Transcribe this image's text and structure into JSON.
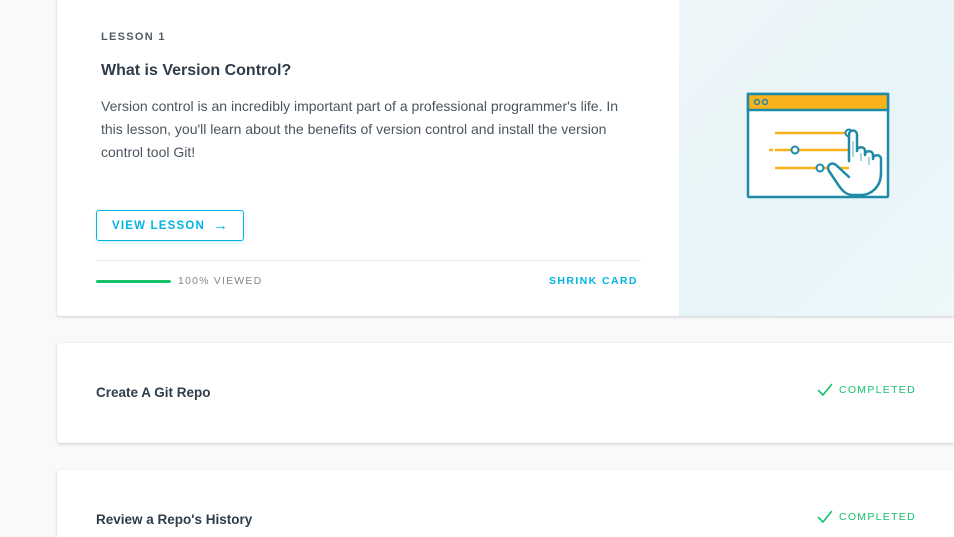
{
  "current_lesson": {
    "eyebrow": "LESSON 1",
    "title": "What is Version Control?",
    "description": "Version control is an incredibly important part of a professional programmer's life. In this lesson, you'll learn about the benefits of version control and install the version control tool Git!",
    "view_button_label": "VIEW LESSON",
    "view_button_icon": "arrow-right-icon",
    "progress_fraction": 1.0,
    "progress_label": "100% VIEWED",
    "shrink_label": "SHRINK CARD",
    "illustration": "settings-sliders-window-with-hand-illustration"
  },
  "lessons": [
    {
      "title": "Create A Git Repo",
      "status": "COMPLETED",
      "status_icon": "checkmark-icon"
    },
    {
      "title": "Review a Repo's History",
      "status": "COMPLETED",
      "status_icon": "checkmark-icon"
    }
  ],
  "colors": {
    "accent": "#02b3e4",
    "success": "#15c26b",
    "illustration_primary": "#1e8aa8",
    "illustration_highlight": "#fab21a"
  }
}
